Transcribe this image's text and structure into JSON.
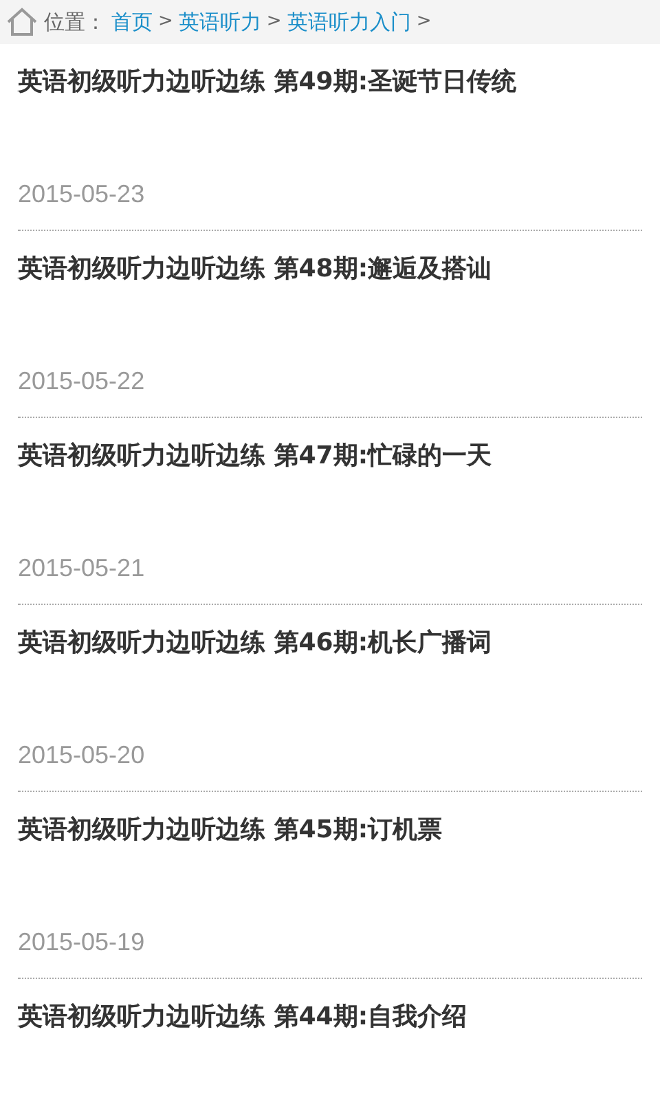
{
  "breadcrumb": {
    "label": "位置：",
    "links": [
      "首页",
      "英语听力",
      "英语听力入门"
    ],
    "separator": ">"
  },
  "articles": [
    {
      "title": "英语初级听力边听边练 第49期:圣诞节日传统",
      "date": "2015-05-23"
    },
    {
      "title": "英语初级听力边听边练 第48期:邂逅及搭讪",
      "date": "2015-05-22"
    },
    {
      "title": "英语初级听力边听边练 第47期:忙碌的一天",
      "date": "2015-05-21"
    },
    {
      "title": "英语初级听力边听边练 第46期:机长广播词",
      "date": "2015-05-20"
    },
    {
      "title": "英语初级听力边听边练 第45期:订机票",
      "date": "2015-05-19"
    },
    {
      "title": "英语初级听力边听边练 第44期:自我介绍"
    }
  ]
}
